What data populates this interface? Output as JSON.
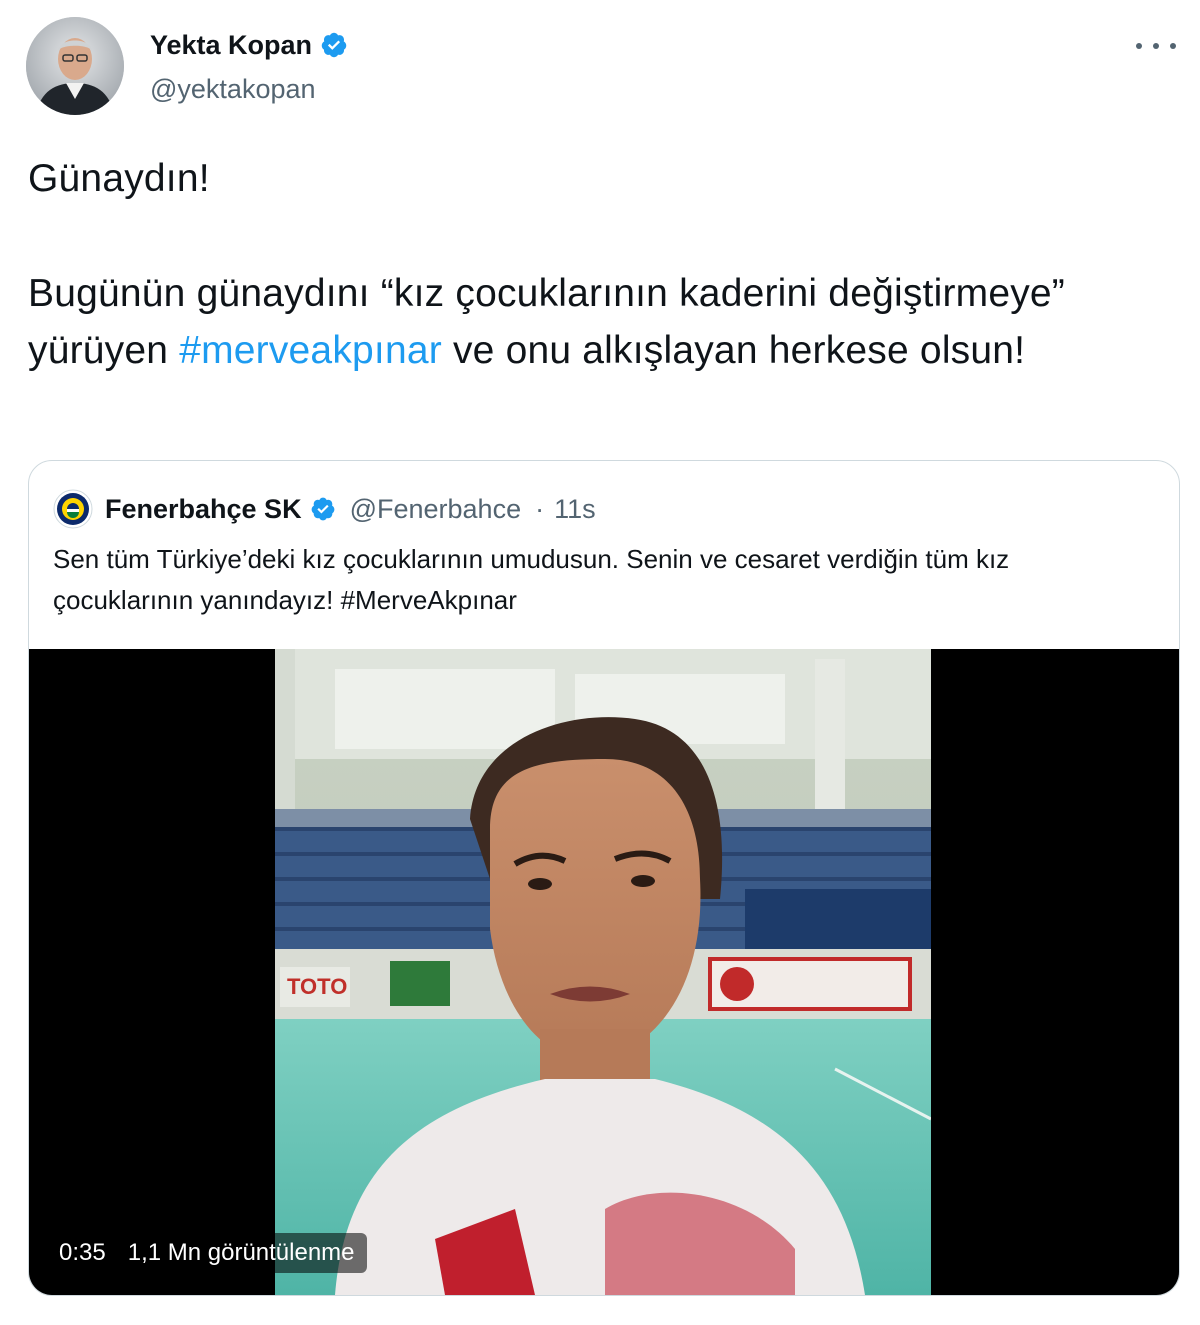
{
  "author": {
    "name": "Yekta Kopan",
    "handle": "@yektakopan",
    "verified": true
  },
  "tweet": {
    "line1": "Günaydın!",
    "line2_part1": "Bugünün günaydını “kız çocuklarının kaderini değiştirmeye” yürüyen ",
    "hashtag": "#merveakpınar",
    "line2_part2": " ve onu alkışlayan herkese olsun!"
  },
  "quoted": {
    "name": "Fenerbahçe SK",
    "handle": "@Fenerbahce",
    "separator": "·",
    "time": "11s",
    "verified": true,
    "text": "Sen tüm Türkiye’deki kız çocuklarının umudusun. Senin ve cesaret verdiğin tüm kız çocuklarının yanındayız! #MerveAkpınar"
  },
  "video": {
    "duration": "0:35",
    "views": "1,1 Mn görüntülenme"
  },
  "icons": {
    "more": "more-horizontal-icon",
    "verified": "verified-badge-icon"
  },
  "colors": {
    "link": "#1d9bf0",
    "secondary_text": "#536471",
    "border": "#cfd9de"
  }
}
